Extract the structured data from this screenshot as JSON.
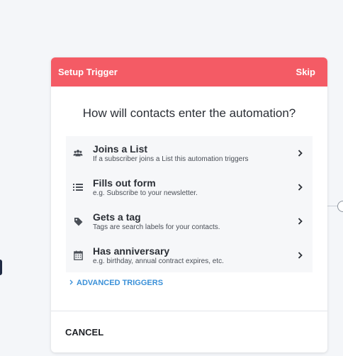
{
  "modal": {
    "title": "Setup Trigger",
    "skip_label": "Skip",
    "question": "How will contacts enter the automation?",
    "options": [
      {
        "title": "Joins a List",
        "description": "If a subscriber joins a List this automation triggers",
        "icon": "users-icon"
      },
      {
        "title": "Fills out form",
        "description": "e.g. Subscribe to your newsletter.",
        "icon": "list-icon"
      },
      {
        "title": "Gets a tag",
        "description": "Tags are search labels for your contacts.",
        "icon": "tag-icon"
      },
      {
        "title": "Has anniversary",
        "description": "e.g. birthday, annual contract expires, etc.",
        "icon": "calendar-icon"
      }
    ],
    "advanced_label": "ADVANCED TRIGGERS",
    "cancel_label": "CANCEL"
  },
  "colors": {
    "header": "#f45b65",
    "link": "#3a90d8",
    "option_bg": "#f6f7f9"
  }
}
